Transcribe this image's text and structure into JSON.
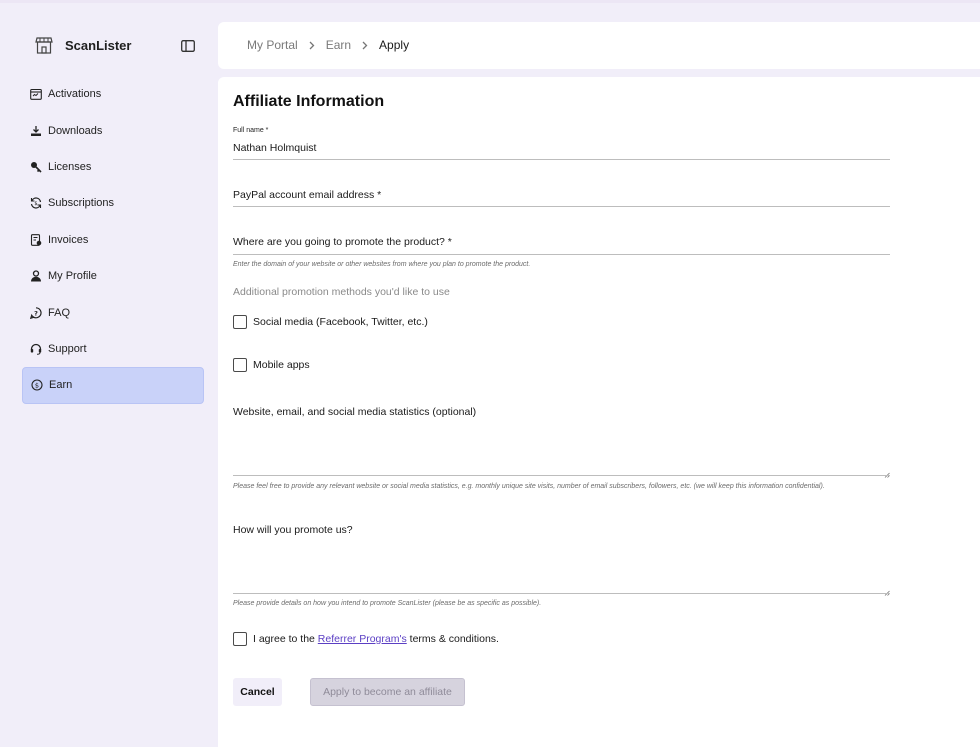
{
  "app": {
    "name": "ScanLister"
  },
  "sidebar": {
    "items": [
      {
        "label": "Activations",
        "icon": "activations-icon"
      },
      {
        "label": "Downloads",
        "icon": "download-icon"
      },
      {
        "label": "Licenses",
        "icon": "key-icon"
      },
      {
        "label": "Subscriptions",
        "icon": "subscriptions-icon"
      },
      {
        "label": "Invoices",
        "icon": "invoice-icon"
      },
      {
        "label": "My Profile",
        "icon": "user-icon"
      },
      {
        "label": "FAQ",
        "icon": "help-icon"
      },
      {
        "label": "Support",
        "icon": "headset-icon"
      },
      {
        "label": "Earn",
        "icon": "dollar-icon",
        "active": true
      }
    ]
  },
  "breadcrumb": [
    "My Portal",
    "Earn",
    "Apply"
  ],
  "form": {
    "title": "Affiliate Information",
    "full_name_label": "Full name *",
    "full_name_value": "Nathan Holmquist",
    "paypal_label": "PayPal account email address *",
    "promote_label": "Where are you going to promote the product? *",
    "promote_helper": "Enter the domain of your website or other websites from where you plan to promote the product.",
    "additional_label": "Additional promotion methods you'd like to use",
    "options": [
      "Social media (Facebook, Twitter, etc.)",
      "Mobile apps"
    ],
    "stats_label": "Website, email, and social media statistics (optional)",
    "stats_helper": "Please feel free to provide any relevant website or social media statistics, e.g. monthly unique site visits, number of email subscribers, followers, etc. (we will keep this information confidential).",
    "how_label": "How will you promote us?",
    "how_helper": "Please provide details on how you intend to promote ScanLister (please be as specific as possible).",
    "agree_prefix": "I agree to the ",
    "agree_link": "Referrer Program's",
    "agree_suffix": " terms & conditions.",
    "cancel_label": "Cancel",
    "apply_label": "Apply to become an affiliate"
  },
  "colors": {
    "active_nav": "#c9d2f9",
    "link": "#5b3fc4",
    "background": "#f1eef9"
  }
}
